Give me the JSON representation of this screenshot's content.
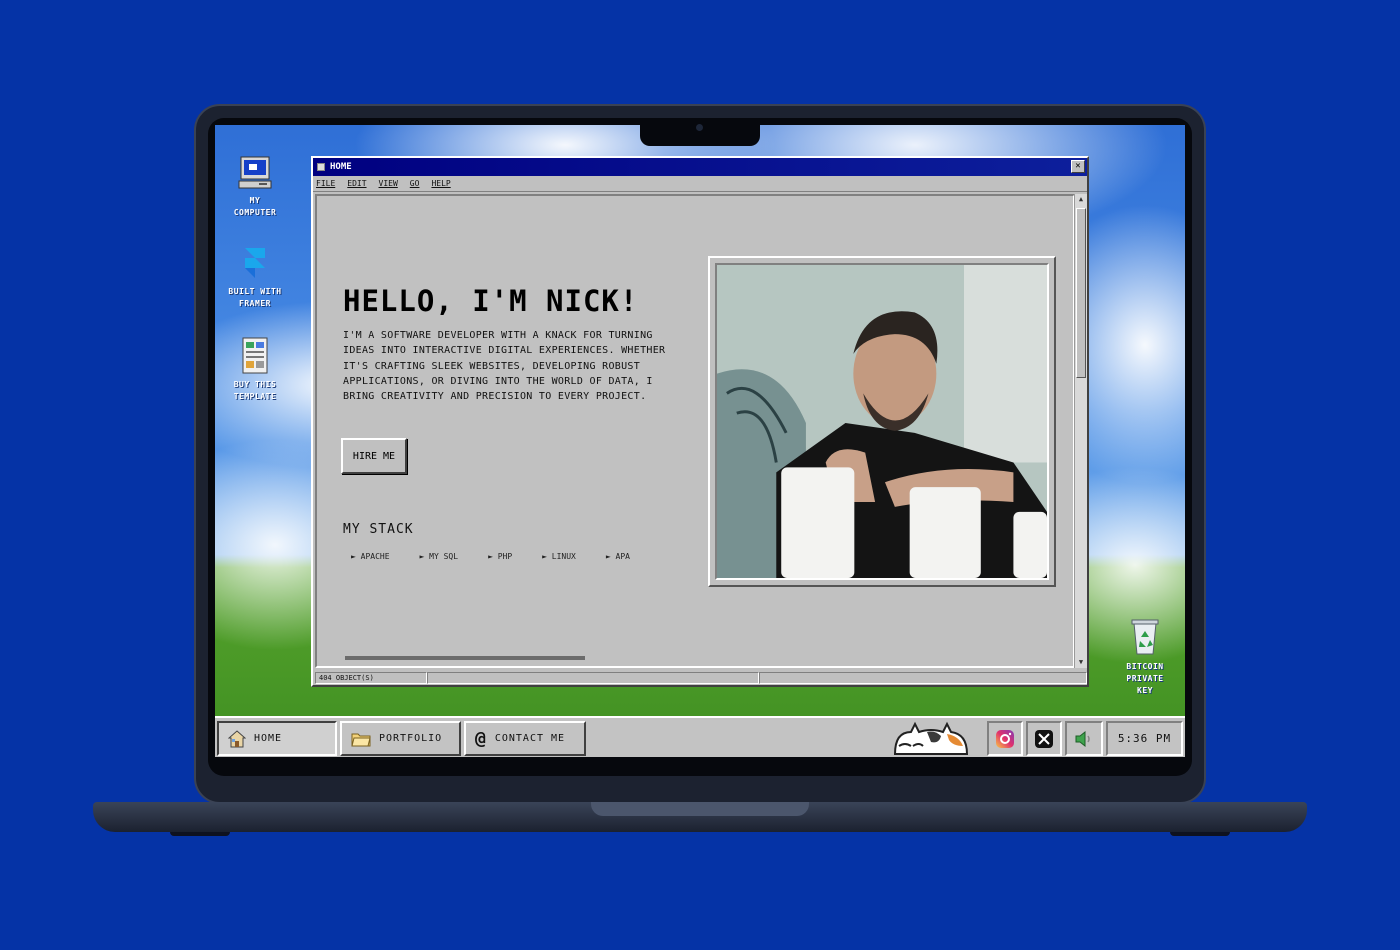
{
  "desktop": {
    "icons": [
      {
        "label_line1": "MY",
        "label_line2": "COMPUTER"
      },
      {
        "label_line1": "BUILT WITH",
        "label_line2": "FRAMER"
      },
      {
        "label_line1": "BUY THIS",
        "label_line2": "TEMPLATE"
      },
      {
        "label_line1": "BITCOIN",
        "label_line2": "PRIVATE",
        "label_line3": "KEY"
      }
    ]
  },
  "window": {
    "title": "HOME",
    "close_glyph": "✕",
    "menu": [
      "FILE",
      "EDIT",
      "VIEW",
      "GO",
      "HELP"
    ],
    "status": "404 OBJECT(S)"
  },
  "hero": {
    "title": "HELLO, I'M NICK!",
    "text": "I'M A SOFTWARE DEVELOPER WITH A KNACK FOR TURNING IDEAS INTO INTERACTIVE DIGITAL EXPERIENCES. WHETHER IT'S CRAFTING SLEEK WEBSITES, DEVELOPING ROBUST APPLICATIONS, OR DIVING INTO THE WORLD OF DATA, I BRING CREATIVITY AND PRECISION TO EVERY PROJECT.",
    "button": "HIRE ME"
  },
  "stack": {
    "title": "MY STACK",
    "items": [
      "► APACHE",
      "► MY SQL",
      "► PHP",
      "► LINUX",
      "► APA"
    ]
  },
  "taskbar": {
    "buttons": [
      "HOME",
      "PORTFOLIO",
      "CONTACT ME"
    ],
    "contact_glyph": "@",
    "clock": "5:36 PM"
  },
  "colors": {
    "desktop_bg": "#0533a6",
    "titlebar": "#000080",
    "window_face": "#c0c0c0"
  },
  "icons": [
    "computer-icon",
    "framer-icon",
    "template-icon",
    "recycle-bin-icon",
    "house-icon",
    "folder-icon",
    "at-icon",
    "cat-icon",
    "instagram-icon",
    "x-icon",
    "speaker-icon"
  ]
}
